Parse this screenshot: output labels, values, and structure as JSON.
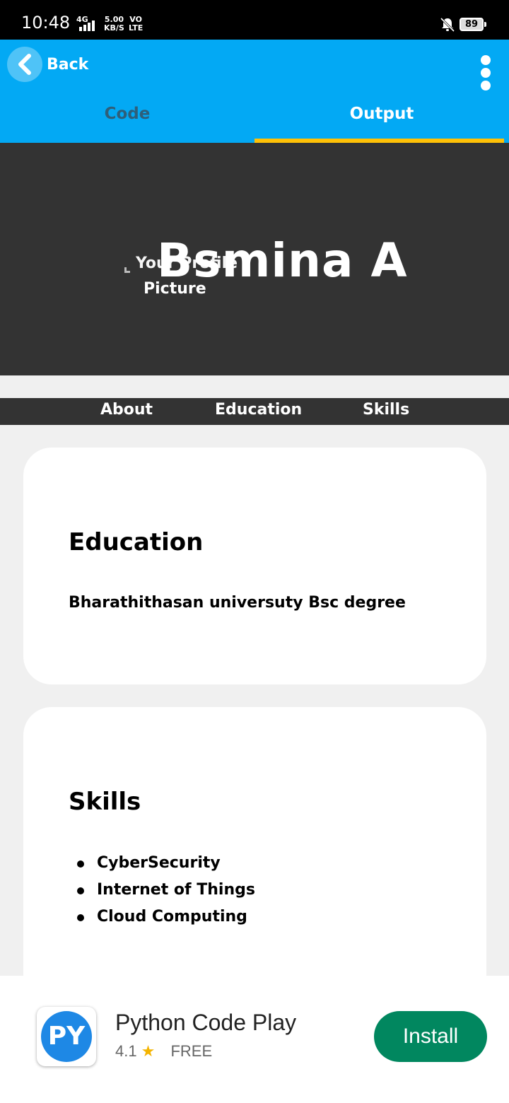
{
  "statusbar": {
    "time": "10:48",
    "network": "4G",
    "speed_top": "5.00",
    "speed_bottom": "KB/S",
    "volte_top": "VO",
    "volte_bottom": "LTE",
    "battery": "89"
  },
  "appbar": {
    "back_label": "Back",
    "tabs": [
      {
        "label": "Code",
        "active": false
      },
      {
        "label": "Output",
        "active": true
      }
    ]
  },
  "hero": {
    "name": "Bsmina A",
    "picture_alt_line1": "Your Profile",
    "picture_alt_line2": "Picture"
  },
  "nav": {
    "links": [
      "About",
      "Education",
      "Skills"
    ]
  },
  "education": {
    "heading": "Education",
    "text": "Bharathithasan universuty Bsc degree"
  },
  "skills": {
    "heading": "Skills",
    "items": [
      "CyberSecurity",
      "Internet of Things",
      "Cloud Computing"
    ]
  },
  "ad": {
    "icon_text": "PY",
    "title": "Python Code Play",
    "rating": "4.1",
    "price": "FREE",
    "install_label": "Install"
  },
  "colors": {
    "appbar": "#03a9f4",
    "tab_indicator": "#ffc107",
    "hero_bg": "#333333",
    "install_button": "#01875f"
  }
}
